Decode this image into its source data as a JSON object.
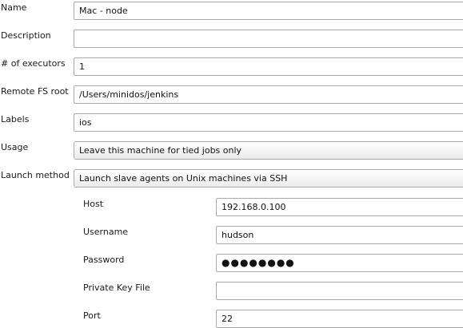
{
  "form": {
    "name": {
      "label": "Name",
      "value": "Mac - node"
    },
    "description": {
      "label": "Description",
      "value": ""
    },
    "executors": {
      "label": "# of executors",
      "value": "1"
    },
    "remote_fs": {
      "label": "Remote FS root",
      "value": "/Users/minidos/jenkins"
    },
    "labels": {
      "label": "Labels",
      "value": "ios"
    },
    "usage": {
      "label": "Usage",
      "value": "Leave this machine for tied jobs only"
    },
    "launch": {
      "label": "Launch method",
      "value": "Launch slave agents on Unix machines via SSH"
    }
  },
  "ssh": {
    "host": {
      "label": "Host",
      "value": "192.168.0.100"
    },
    "username": {
      "label": "Username",
      "value": "hudson"
    },
    "password": {
      "label": "Password",
      "value": "●●●●●●●●"
    },
    "private_key": {
      "label": "Private Key File",
      "value": ""
    },
    "port": {
      "label": "Port",
      "value": "22"
    }
  }
}
